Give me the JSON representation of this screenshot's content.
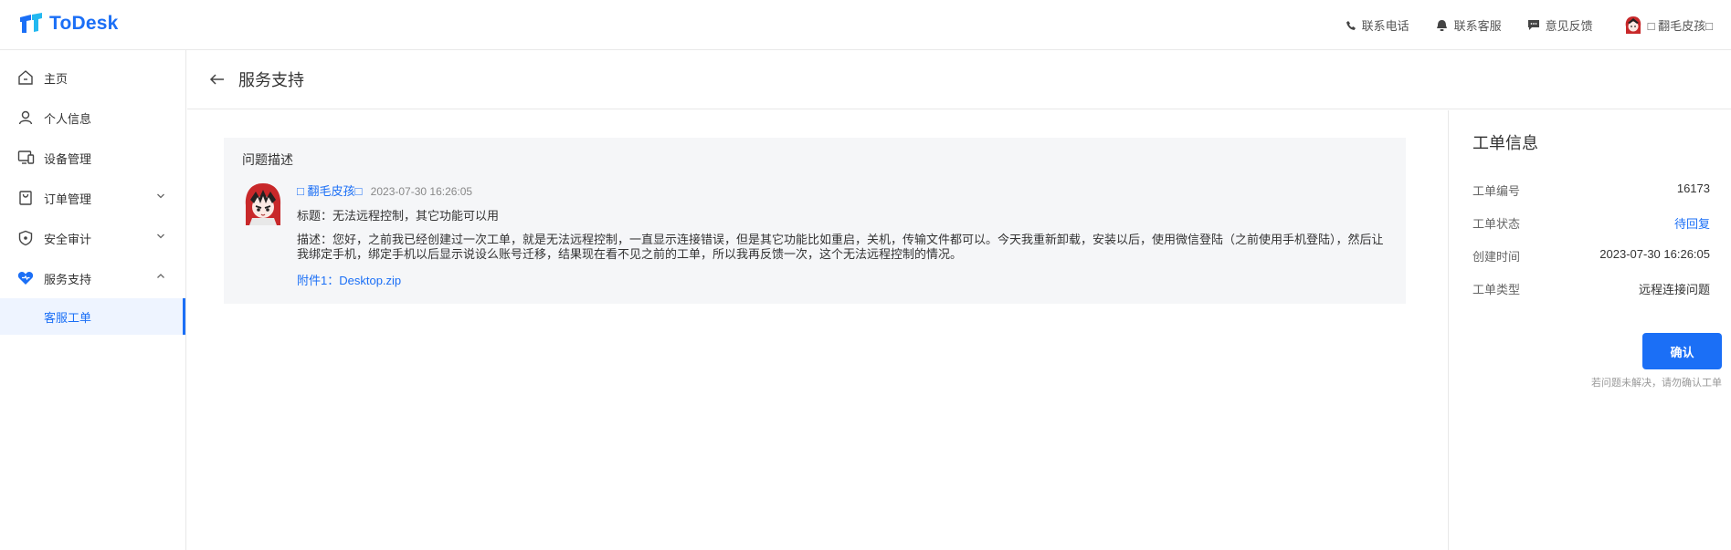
{
  "app": {
    "logo_text": "ToDesk"
  },
  "topnav": {
    "phone": "联系电话",
    "service": "联系客服",
    "feedback": "意见反馈",
    "username": "□ 翻毛皮孩□"
  },
  "sidebar": {
    "items": [
      {
        "label": "主页"
      },
      {
        "label": "个人信息"
      },
      {
        "label": "设备管理"
      },
      {
        "label": "订单管理"
      },
      {
        "label": "安全审计"
      },
      {
        "label": "服务支持"
      }
    ],
    "sub_item": "客服工单"
  },
  "page": {
    "title": "服务支持"
  },
  "ticket": {
    "section_title": "问题描述",
    "user": "□ 翻毛皮孩□",
    "time": "2023-07-30 16:26:05",
    "subject": "标题：无法远程控制，其它功能可以用",
    "description": "描述：您好，之前我已经创建过一次工单，就是无法远程控制，一直显示连接错误，但是其它功能比如重启，关机，传输文件都可以。今天我重新卸载，安装以后，使用微信登陆（之前使用手机登陆），然后让我绑定手机，绑定手机以后显示说设么账号迁移，结果现在看不见之前的工单，所以我再反馈一次，这个无法远程控制的情况。",
    "attachment": "附件1：Desktop.zip"
  },
  "info": {
    "title": "工单信息",
    "rows": [
      {
        "key": "工单编号",
        "value": "16173"
      },
      {
        "key": "工单状态",
        "value": "待回复"
      },
      {
        "key": "创建时间",
        "value": "2023-07-30 16:26:05"
      },
      {
        "key": "工单类型",
        "value": "远程连接问题"
      }
    ],
    "confirm_label": "确认",
    "hint": "若问题未解决，请勿确认工单"
  },
  "colors": {
    "accent": "#1b6ff6",
    "panel": "#f5f6f8",
    "border": "#e8e8e8"
  }
}
